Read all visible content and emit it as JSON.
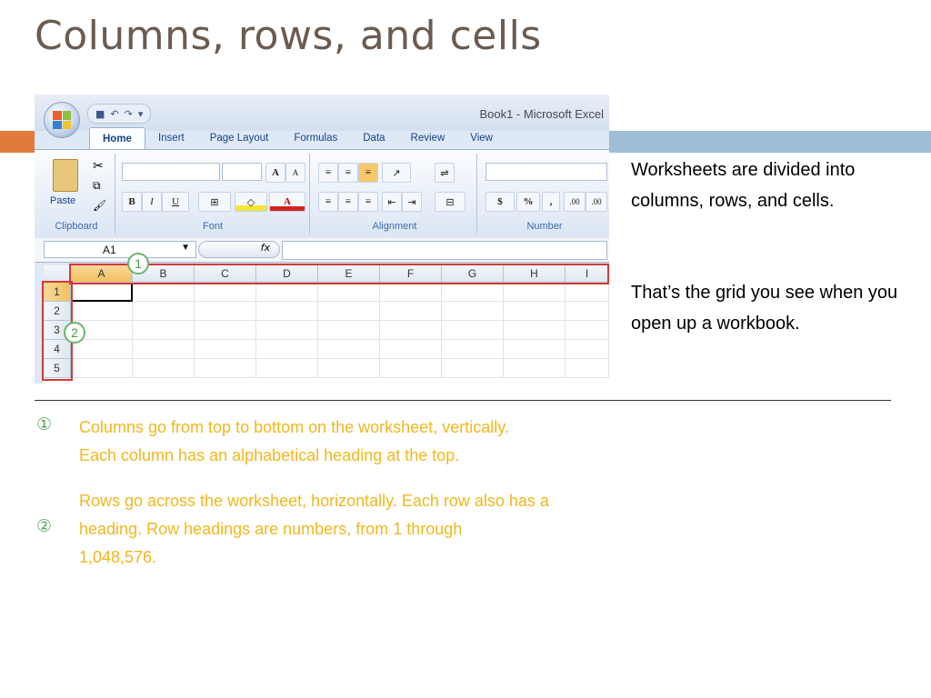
{
  "slide": {
    "title": "Columns, rows, and cells",
    "accent_colors": {
      "left_bar": "#e07b3c",
      "right_bar": "#9fbdd6",
      "note_text": "#f2b71d",
      "callout": "#5aa65a"
    }
  },
  "excel": {
    "window_title": "Book1 - Microsoft Excel",
    "tabs": [
      "Home",
      "Insert",
      "Page Layout",
      "Formulas",
      "Data",
      "Review",
      "View"
    ],
    "active_tab": "Home",
    "groups": {
      "clipboard": "Clipboard",
      "font": "Font",
      "alignment": "Alignment",
      "number": "Number"
    },
    "paste_label": "Paste",
    "font_buttons": {
      "bold": "B",
      "italic": "I",
      "underline": "U",
      "grow": "A",
      "shrink": "A",
      "color": "A"
    },
    "number_buttons": {
      "currency": "$",
      "percent": "%",
      "comma": ",",
      "inc_decimal": ".00",
      "dec_decimal": ".00"
    },
    "name_box": "A1",
    "fx_label": "fx",
    "columns": [
      "A",
      "B",
      "C",
      "D",
      "E",
      "F",
      "G",
      "H",
      "I"
    ],
    "rows": [
      "1",
      "2",
      "3",
      "4",
      "5"
    ],
    "selected_column": "A",
    "selected_row": "1",
    "callout_1": "1",
    "callout_2": "2"
  },
  "side_text": {
    "p1": "Worksheets are divided into columns, rows, and cells.",
    "p2": "That’s the grid you see when you open up a workbook."
  },
  "notes": [
    {
      "marker": "①",
      "line1": "Columns go from top to bottom on the worksheet, vertically.",
      "line2": "Each column has an alphabetical heading at the top."
    },
    {
      "marker": "②",
      "line1": "Rows go across the worksheet, horizontally. Each row also has a",
      "line2": "heading. Row headings are numbers, from 1 through",
      "line3": "1,048,576."
    }
  ]
}
